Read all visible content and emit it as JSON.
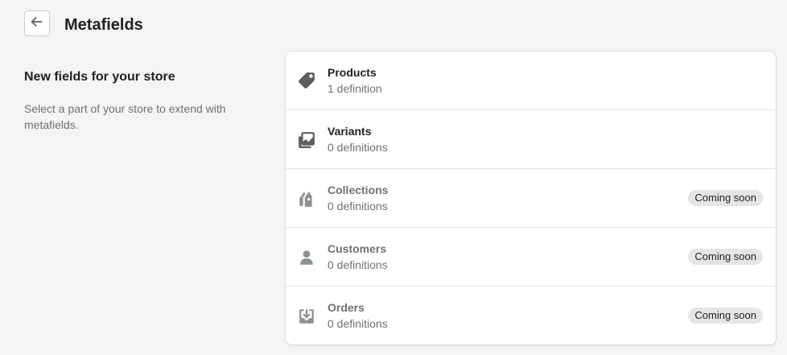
{
  "header": {
    "title": "Metafields",
    "back_icon": "arrow-left-icon"
  },
  "intro": {
    "heading": "New fields for your store",
    "description": "Select a part of your store to extend with metafields."
  },
  "resources": [
    {
      "name": "Products",
      "definitions": "1 definition",
      "icon": "tag-icon",
      "badge": ""
    },
    {
      "name": "Variants",
      "definitions": "0 definitions",
      "icon": "variants-icon",
      "badge": ""
    },
    {
      "name": "Collections",
      "definitions": "0 definitions",
      "icon": "collections-icon",
      "badge": "Coming soon"
    },
    {
      "name": "Customers",
      "definitions": "0 definitions",
      "icon": "customer-icon",
      "badge": "Coming soon"
    },
    {
      "name": "Orders",
      "definitions": "0 definitions",
      "icon": "orders-icon",
      "badge": "Coming soon"
    }
  ],
  "colors": {
    "background": "#f4f4f4",
    "card": "#ffffff",
    "icon_active": "#5c5f62",
    "icon_muted": "#8c9196",
    "badge_bg": "#e4e5e7"
  }
}
